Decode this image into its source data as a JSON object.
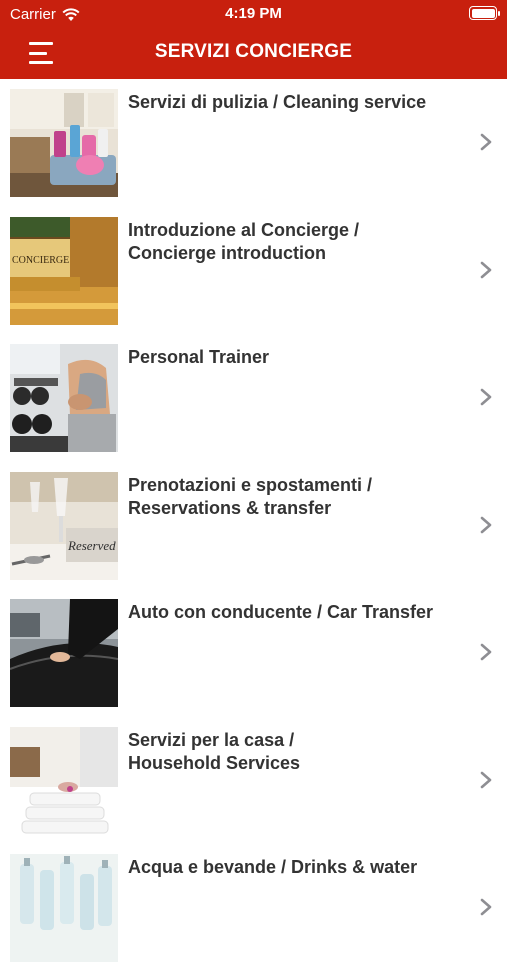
{
  "status_bar": {
    "carrier": "Carrier",
    "time": "4:19 PM"
  },
  "header": {
    "title": "SERVIZI CONCIERGE",
    "color": "#c8200e"
  },
  "items": [
    {
      "label": "Servizi di pulizia / Cleaning service",
      "image": "cleaning-supplies"
    },
    {
      "label": "Introduzione al Concierge / \nConcierge introduction",
      "image": "concierge-desk",
      "sign": "CONCIERGE"
    },
    {
      "label": "Personal Trainer",
      "image": "gym-trainer"
    },
    {
      "label": "Prenotazioni e spostamenti / \nReservations & transfer",
      "image": "reserved-table",
      "sign": "Reserved"
    },
    {
      "label": "Auto con conducente / Car Transfer",
      "image": "car-chauffeur"
    },
    {
      "label": "Servizi per la casa / \nHousehold Services",
      "image": "towels-maid"
    },
    {
      "label": "Acqua e bevande / Drinks & water",
      "image": "water-bottles"
    }
  ]
}
